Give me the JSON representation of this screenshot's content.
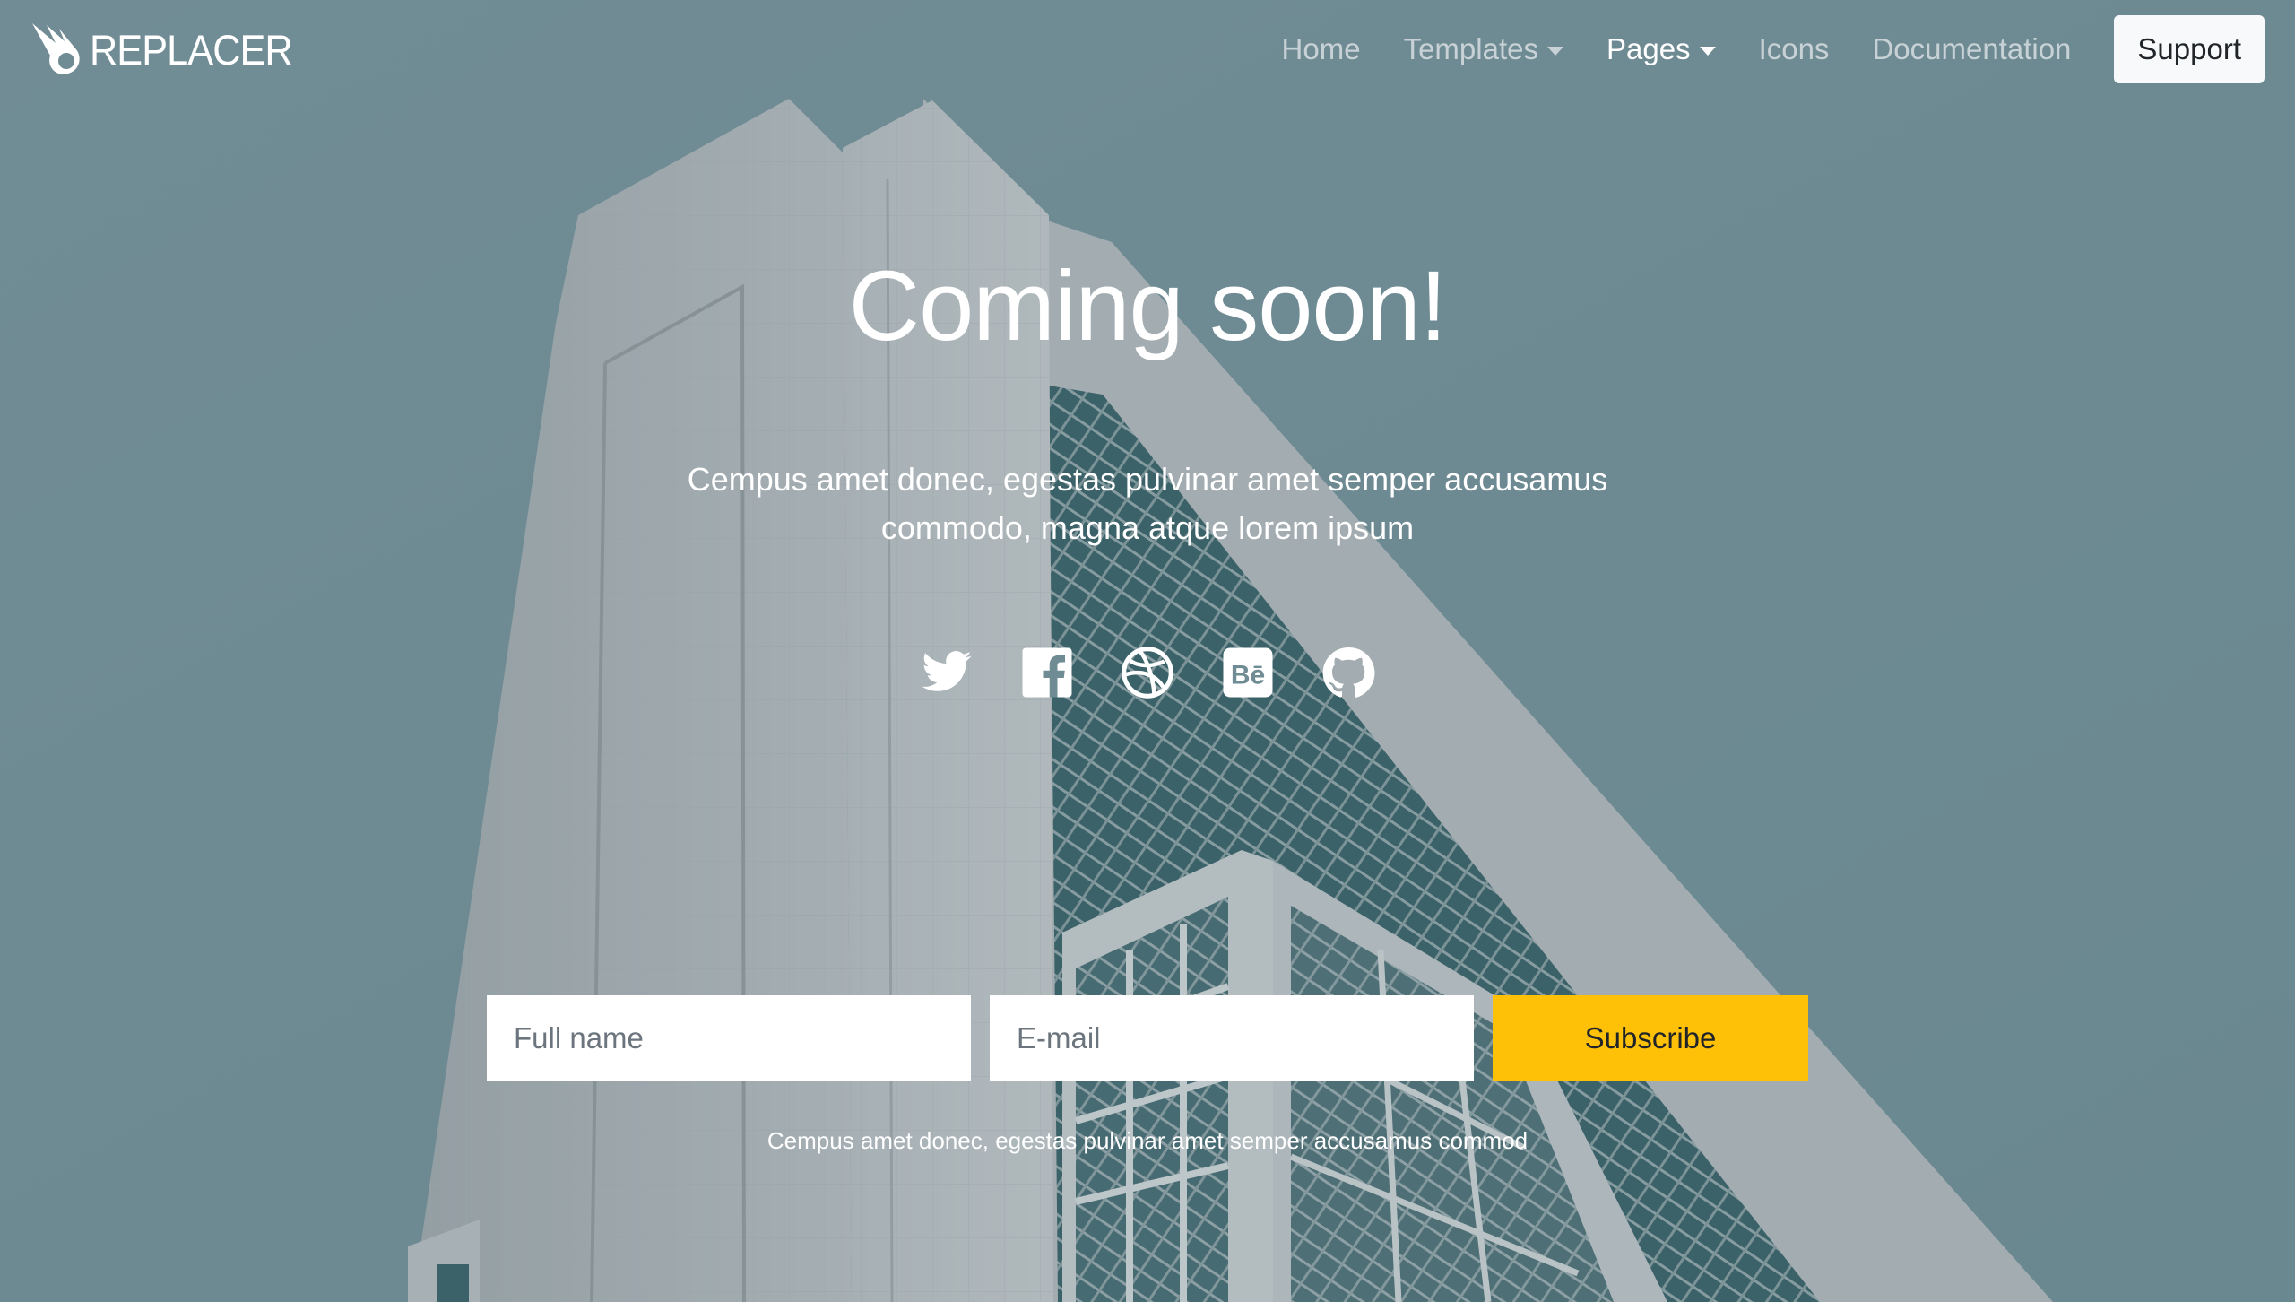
{
  "brand": {
    "name": "REPLACER"
  },
  "nav": {
    "items": [
      {
        "label": "Home",
        "dropdown": false,
        "active": false
      },
      {
        "label": "Templates",
        "dropdown": true,
        "active": false
      },
      {
        "label": "Pages",
        "dropdown": true,
        "active": true
      },
      {
        "label": "Icons",
        "dropdown": false,
        "active": false
      },
      {
        "label": "Documentation",
        "dropdown": false,
        "active": false
      }
    ],
    "support_label": "Support"
  },
  "hero": {
    "title": "Coming soon!",
    "lead_line1": "Cempus amet donec, egestas pulvinar amet semper accusamus",
    "lead_line2": "commodo, magna atque lorem ipsum",
    "social": [
      "twitter-icon",
      "facebook-icon",
      "dribbble-icon",
      "behance-icon",
      "github-icon"
    ]
  },
  "form": {
    "name_placeholder": "Full name",
    "email_placeholder": "E-mail",
    "subscribe_label": "Subscribe",
    "note": "Cempus amet donec, egestas pulvinar amet semper accusamus commod"
  },
  "colors": {
    "sky": "#6f8b94",
    "building_light": "#b9bcbf",
    "glass": "#2f5a60",
    "subscribe": "#ffc107",
    "support_bg": "#f8f9fa"
  }
}
